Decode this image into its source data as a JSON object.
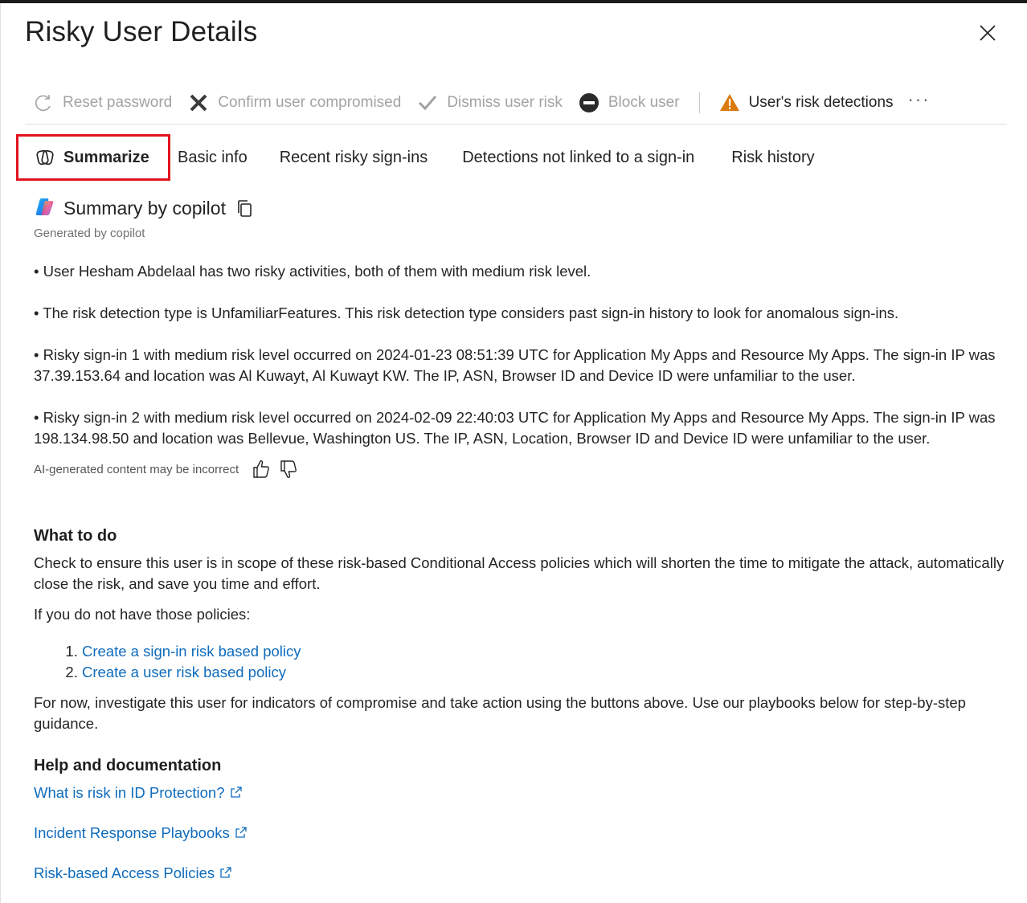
{
  "panel": {
    "title": "Risky User Details",
    "close_label": "Close"
  },
  "toolbar": {
    "reset_password": "Reset password",
    "confirm_compromised": "Confirm user compromised",
    "dismiss_risk": "Dismiss user risk",
    "block_user": "Block user",
    "risk_detections": "User's risk detections",
    "more": "···"
  },
  "tabs": [
    {
      "label": "Summarize",
      "selected": true
    },
    {
      "label": "Basic info"
    },
    {
      "label": "Recent risky sign-ins"
    },
    {
      "label": "Detections not linked to a sign-in"
    },
    {
      "label": "Risk history"
    }
  ],
  "summary": {
    "heading": "Summary by copilot",
    "generated_by": "Generated by copilot",
    "bullets": [
      "• User Hesham Abdelaal has two risky activities, both of them with medium risk level.",
      "• The risk detection type is UnfamiliarFeatures. This risk detection type considers past sign-in history to look for anomalous sign-ins.",
      "• Risky sign-in 1 with medium risk level occurred on 2024-01-23 08:51:39 UTC for Application My Apps and Resource My Apps. The sign-in IP was 37.39.153.64 and location was Al Kuwayt, Al Kuwayt KW. The IP, ASN, Browser ID and Device ID were unfamiliar to the user.",
      "• Risky sign-in 2 with medium risk level occurred on 2024-02-09 22:40:03 UTC for Application My Apps and Resource My Apps. The sign-in IP was 198.134.98.50 and location was Bellevue, Washington US. The IP, ASN, Location, Browser ID and Device ID were unfamiliar to the user."
    ],
    "ai_note": "AI-generated content may be incorrect"
  },
  "what_to_do": {
    "heading": "What to do",
    "para1": "Check to ensure this user is in scope of these risk-based Conditional Access policies which will shorten the time to mitigate the attack, automatically close the risk, and save you time and effort.",
    "para2": "If you do not have those policies:",
    "links": [
      "Create a sign-in risk based policy",
      "Create a user risk based policy"
    ],
    "para3": "For now, investigate this user for indicators of compromise and take action using the buttons above. Use our playbooks below for step-by-step guidance."
  },
  "help": {
    "heading": "Help and documentation",
    "links": [
      "What is risk in ID Protection?",
      "Incident Response Playbooks",
      "Risk-based Access Policies"
    ]
  },
  "colors": {
    "link": "#0f6cbd",
    "highlight_border": "#e0141e",
    "warning": "#da7b0f",
    "disabled_text": "#a3a3a3"
  }
}
